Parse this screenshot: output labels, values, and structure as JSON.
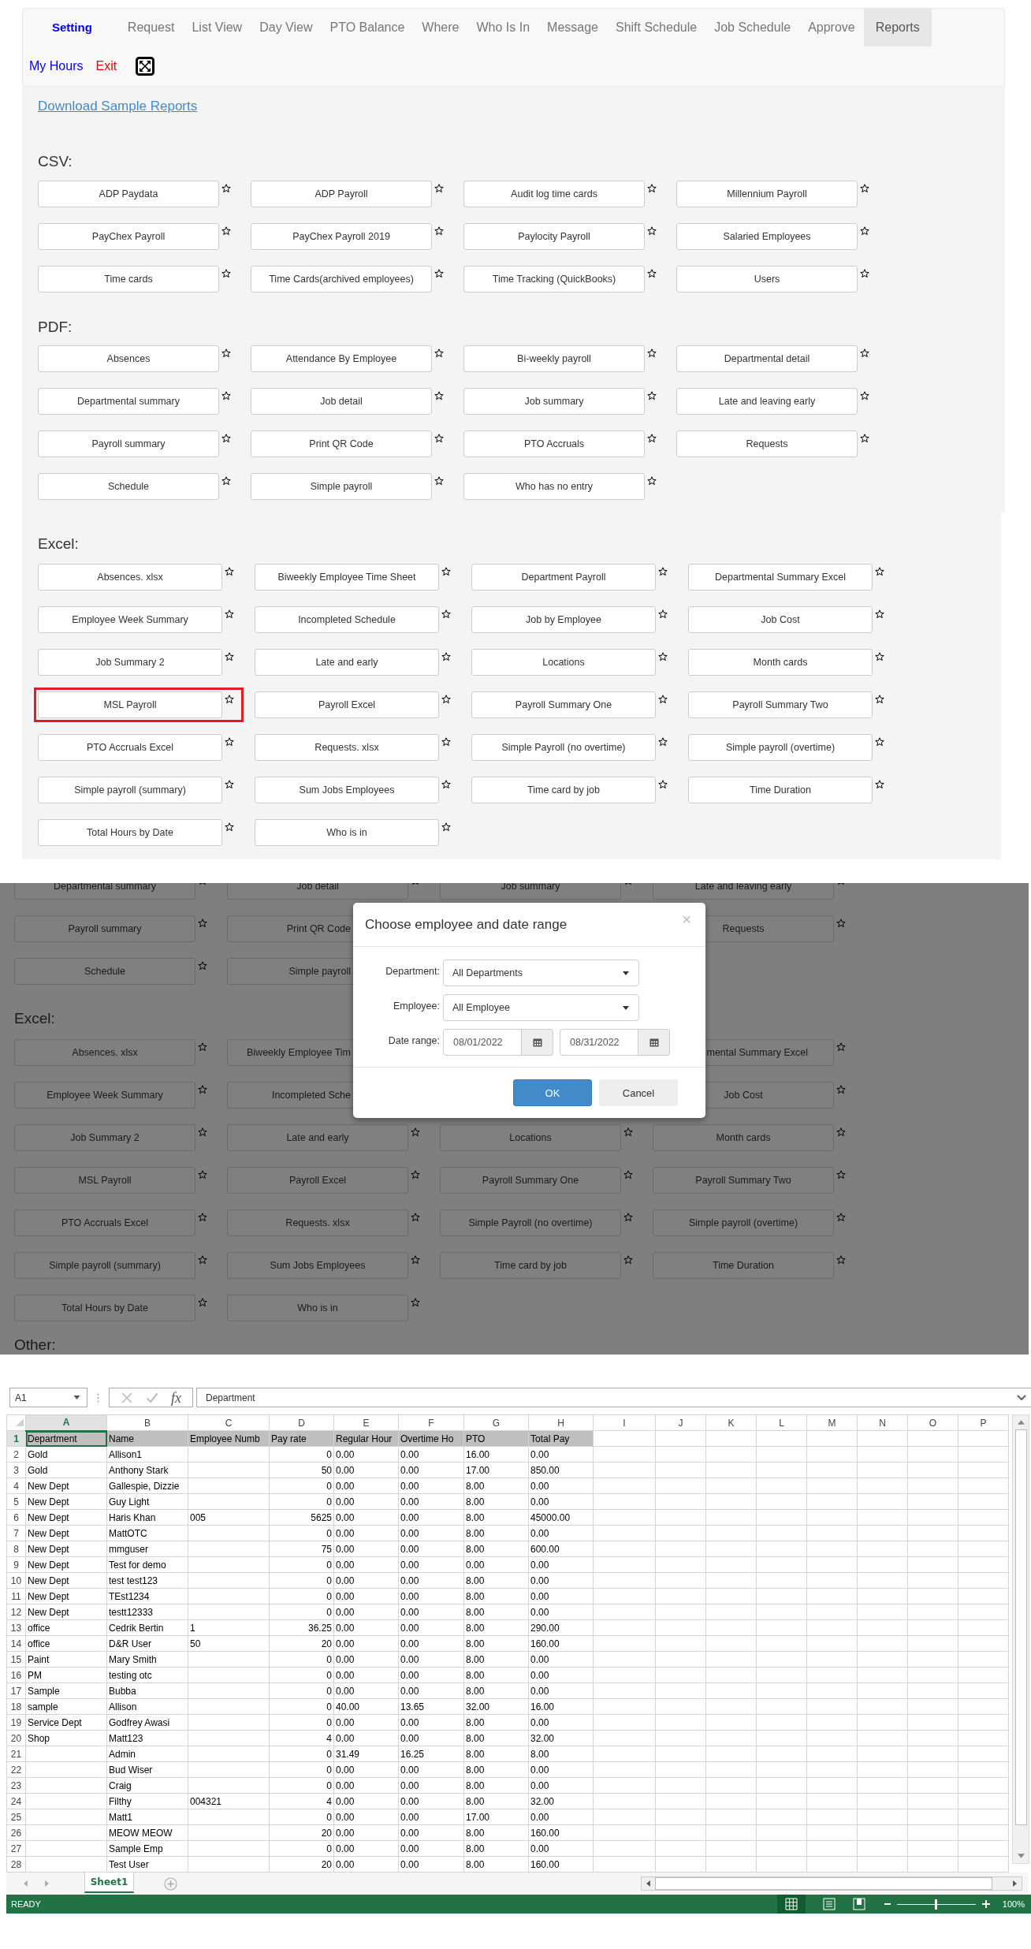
{
  "nav": {
    "brand": "Setting",
    "tabs": [
      {
        "label": "Request",
        "selected": false
      },
      {
        "label": "List View",
        "selected": false
      },
      {
        "label": "Day View",
        "selected": false
      },
      {
        "label": "PTO Balance",
        "selected": false
      },
      {
        "label": "Where",
        "selected": false
      },
      {
        "label": "Who Is In",
        "selected": false
      },
      {
        "label": "Message",
        "selected": false
      },
      {
        "label": "Shift Schedule",
        "selected": false
      },
      {
        "label": "Job Schedule",
        "selected": false
      },
      {
        "label": "Approve",
        "selected": false
      },
      {
        "label": "Reports",
        "selected": true
      }
    ],
    "links": [
      {
        "label": "My Hours",
        "kind": "hours"
      },
      {
        "label": "Exit",
        "kind": "exit"
      }
    ]
  },
  "download_link": "Download Sample Reports",
  "report_sections": [
    {
      "title": "CSV:",
      "reports": [
        {
          "label": "ADP Paydata"
        },
        {
          "label": "ADP Payroll"
        },
        {
          "label": "Audit log time cards"
        },
        {
          "label": "Millennium Payroll"
        },
        {
          "label": "PayChex Payroll"
        },
        {
          "label": "PayChex Payroll 2019"
        },
        {
          "label": "Paylocity Payroll"
        },
        {
          "label": "Salaried Employees"
        },
        {
          "label": "Time cards"
        },
        {
          "label": "Time Cards(archived employees)"
        },
        {
          "label": "Time Tracking (QuickBooks)"
        },
        {
          "label": "Users"
        }
      ]
    },
    {
      "title": "PDF:",
      "reports": [
        {
          "label": "Absences"
        },
        {
          "label": "Attendance By Employee"
        },
        {
          "label": "Bi-weekly payroll"
        },
        {
          "label": "Departmental detail"
        },
        {
          "label": "Departmental summary"
        },
        {
          "label": "Job detail"
        },
        {
          "label": "Job summary"
        },
        {
          "label": "Late and leaving early"
        },
        {
          "label": "Payroll summary"
        },
        {
          "label": "Print QR Code"
        },
        {
          "label": "PTO Accruals"
        },
        {
          "label": "Requests"
        },
        {
          "label": "Schedule"
        },
        {
          "label": "Simple payroll"
        },
        {
          "label": "Who has no entry"
        }
      ]
    },
    {
      "title": "Excel:",
      "reports": [
        {
          "label": "Absences. xlsx",
          "highlighted": false
        },
        {
          "label": "Biweekly Employee Time Sheet",
          "highlighted": false
        },
        {
          "label": "Department Payroll",
          "highlighted": false
        },
        {
          "label": "Departmental Summary Excel",
          "highlighted": false
        },
        {
          "label": "Employee Week Summary",
          "highlighted": false
        },
        {
          "label": "Incompleted Schedule",
          "highlighted": false
        },
        {
          "label": "Job by Employee",
          "highlighted": false
        },
        {
          "label": "Job Cost",
          "highlighted": false
        },
        {
          "label": "Job Summary 2",
          "highlighted": false
        },
        {
          "label": "Late and early",
          "highlighted": false
        },
        {
          "label": "Locations",
          "highlighted": false
        },
        {
          "label": "Month cards",
          "highlighted": false
        },
        {
          "label": "MSL Payroll",
          "highlighted": true
        },
        {
          "label": "Payroll Excel",
          "highlighted": false
        },
        {
          "label": "Payroll Summary One",
          "highlighted": false
        },
        {
          "label": "Payroll Summary Two",
          "highlighted": false
        },
        {
          "label": "PTO Accruals Excel",
          "highlighted": false
        },
        {
          "label": "Requests. xlsx",
          "highlighted": false
        },
        {
          "label": "Simple Payroll (no overtime)",
          "highlighted": false
        },
        {
          "label": "Simple payroll (overtime)",
          "highlighted": false
        },
        {
          "label": "Simple payroll (summary)",
          "highlighted": false
        },
        {
          "label": "Sum Jobs Employees",
          "highlighted": false
        },
        {
          "label": "Time card by job",
          "highlighted": false
        },
        {
          "label": "Time Duration",
          "highlighted": false
        },
        {
          "label": "Total Hours by Date",
          "highlighted": false
        },
        {
          "label": "Who is in",
          "highlighted": false
        }
      ]
    }
  ],
  "dialog_view": {
    "background": [
      {
        "kind": "row",
        "cells": [
          {
            "kind": "full",
            "label": "Departmental summary"
          },
          {
            "kind": "full",
            "label": "Job detail"
          },
          {
            "kind": "full",
            "label": "Job summary"
          },
          {
            "kind": "full",
            "label": "Late and leaving early"
          }
        ]
      },
      {
        "kind": "row",
        "cells": [
          {
            "kind": "full",
            "label": "Payroll summary"
          },
          {
            "kind": "cut_right",
            "label": "Print QR Code"
          },
          {
            "kind": "covered"
          },
          {
            "kind": "full",
            "label": "Requests"
          }
        ]
      },
      {
        "kind": "row",
        "cells": [
          {
            "kind": "full",
            "label": "Schedule"
          },
          {
            "kind": "cut_right",
            "label": "Simple payroll"
          },
          {
            "kind": "covered"
          }
        ]
      },
      {
        "kind": "heading",
        "text": "Excel:"
      },
      {
        "kind": "row",
        "cells": [
          {
            "kind": "full",
            "label": "Absences. xlsx"
          },
          {
            "kind": "cut_right",
            "label": "Biweekly Employee Tim"
          },
          {
            "kind": "covered"
          },
          {
            "kind": "cut_left",
            "label": "mental Summary Excel"
          }
        ]
      },
      {
        "kind": "row",
        "cells": [
          {
            "kind": "full",
            "label": "Employee Week Summary"
          },
          {
            "kind": "cut_right",
            "label": "Incompleted Sche"
          },
          {
            "kind": "covered"
          },
          {
            "kind": "full",
            "label": "Job Cost"
          }
        ]
      },
      {
        "kind": "row",
        "cells": [
          {
            "kind": "full",
            "label": "Job Summary 2"
          },
          {
            "kind": "full",
            "label": "Late and early"
          },
          {
            "kind": "full",
            "label": "Locations"
          },
          {
            "kind": "full",
            "label": "Month cards"
          }
        ]
      },
      {
        "kind": "row",
        "cells": [
          {
            "kind": "full",
            "label": "MSL Payroll"
          },
          {
            "kind": "full",
            "label": "Payroll Excel"
          },
          {
            "kind": "full",
            "label": "Payroll Summary One"
          },
          {
            "kind": "full",
            "label": "Payroll Summary Two"
          }
        ]
      },
      {
        "kind": "row",
        "cells": [
          {
            "kind": "full",
            "label": "PTO Accruals Excel"
          },
          {
            "kind": "full",
            "label": "Requests. xlsx"
          },
          {
            "kind": "full",
            "label": "Simple Payroll (no overtime)"
          },
          {
            "kind": "full",
            "label": "Simple payroll (overtime)"
          }
        ]
      },
      {
        "kind": "row",
        "cells": [
          {
            "kind": "full",
            "label": "Simple payroll (summary)"
          },
          {
            "kind": "full",
            "label": "Sum Jobs Employees"
          },
          {
            "kind": "full",
            "label": "Time card by job"
          },
          {
            "kind": "full",
            "label": "Time Duration"
          }
        ]
      },
      {
        "kind": "row",
        "cells": [
          {
            "kind": "full",
            "label": "Total Hours by Date"
          },
          {
            "kind": "full",
            "label": "Who is in"
          }
        ]
      },
      {
        "kind": "heading",
        "text": "Other:"
      }
    ],
    "modal": {
      "title": "Choose employee and date range",
      "close": "×",
      "fields": [
        {
          "label": "Department:",
          "kind": "select",
          "value": "All Departments"
        },
        {
          "label": "Employee:",
          "kind": "select",
          "value": "All Employee"
        },
        {
          "label": "Date range:",
          "kind": "date_range",
          "values": [
            "08/01/2022",
            "08/31/2022"
          ]
        }
      ],
      "buttons": [
        {
          "label": "OK",
          "kind": "primary"
        },
        {
          "label": "Cancel",
          "kind": "default"
        }
      ]
    }
  },
  "spreadsheet": {
    "name_box": "A1",
    "function_symbol": "fx",
    "formula": "Department",
    "columns": [
      {
        "label": "A",
        "selected": true
      },
      {
        "label": "B",
        "selected": false
      },
      {
        "label": "C",
        "selected": false
      },
      {
        "label": "D",
        "selected": false
      },
      {
        "label": "E",
        "selected": false
      },
      {
        "label": "F",
        "selected": false
      },
      {
        "label": "G",
        "selected": false
      },
      {
        "label": "H",
        "selected": false
      },
      {
        "label": "I",
        "selected": false
      },
      {
        "label": "J",
        "selected": false
      },
      {
        "label": "K",
        "selected": false
      },
      {
        "label": "L",
        "selected": false
      },
      {
        "label": "M",
        "selected": false
      },
      {
        "label": "N",
        "selected": false
      },
      {
        "label": "O",
        "selected": false
      },
      {
        "label": "P",
        "selected": false
      }
    ],
    "rows": [
      {
        "number": "1",
        "selected": true,
        "kind": "header",
        "cells": [
          "Department",
          "Name",
          "Employee Numb",
          "Pay rate",
          "Regular Hour",
          "Overtime Ho",
          "PTO",
          "Total Pay"
        ]
      },
      {
        "number": "2",
        "selected": false,
        "kind": "data",
        "cells": [
          "Gold",
          "Allison1",
          null,
          "0",
          "0.00",
          "0.00",
          "16.00",
          "0.00"
        ]
      },
      {
        "number": "3",
        "selected": false,
        "kind": "data",
        "cells": [
          "Gold",
          "Anthony Stark",
          null,
          "50",
          "0.00",
          "0.00",
          "17.00",
          "850.00"
        ]
      },
      {
        "number": "4",
        "selected": false,
        "kind": "data",
        "cells": [
          "New Dept",
          "Gallespie, Dizzie",
          null,
          "0",
          "0.00",
          "0.00",
          "8.00",
          "0.00"
        ]
      },
      {
        "number": "5",
        "selected": false,
        "kind": "data",
        "cells": [
          "New Dept",
          "Guy Light",
          null,
          "0",
          "0.00",
          "0.00",
          "8.00",
          "0.00"
        ]
      },
      {
        "number": "6",
        "selected": false,
        "kind": "data",
        "cells": [
          "New Dept",
          "Haris Khan",
          "005",
          "5625",
          "0.00",
          "0.00",
          "8.00",
          "45000.00"
        ]
      },
      {
        "number": "7",
        "selected": false,
        "kind": "data",
        "cells": [
          "New Dept",
          "MattOTC",
          null,
          "0",
          "0.00",
          "0.00",
          "8.00",
          "0.00"
        ]
      },
      {
        "number": "8",
        "selected": false,
        "kind": "data",
        "cells": [
          "New Dept",
          "mmguser",
          null,
          "75",
          "0.00",
          "0.00",
          "8.00",
          "600.00"
        ]
      },
      {
        "number": "9",
        "selected": false,
        "kind": "data",
        "cells": [
          "New Dept",
          "Test for demo",
          null,
          "0",
          "0.00",
          "0.00",
          "0.00",
          "0.00"
        ]
      },
      {
        "number": "10",
        "selected": false,
        "kind": "data",
        "cells": [
          "New Dept",
          "test test123",
          null,
          "0",
          "0.00",
          "0.00",
          "8.00",
          "0.00"
        ]
      },
      {
        "number": "11",
        "selected": false,
        "kind": "data",
        "cells": [
          "New Dept",
          "TEst1234",
          null,
          "0",
          "0.00",
          "0.00",
          "8.00",
          "0.00"
        ]
      },
      {
        "number": "12",
        "selected": false,
        "kind": "data",
        "cells": [
          "New Dept",
          "testt12333",
          null,
          "0",
          "0.00",
          "0.00",
          "8.00",
          "0.00"
        ]
      },
      {
        "number": "13",
        "selected": false,
        "kind": "data",
        "cells": [
          "office",
          "Cedrik Bertin",
          "1",
          "36.25",
          "0.00",
          "0.00",
          "8.00",
          "290.00"
        ]
      },
      {
        "number": "14",
        "selected": false,
        "kind": "data",
        "cells": [
          "office",
          "D&R User",
          "50",
          "20",
          "0.00",
          "0.00",
          "8.00",
          "160.00"
        ]
      },
      {
        "number": "15",
        "selected": false,
        "kind": "data",
        "cells": [
          "Paint",
          "Mary Smith",
          null,
          "0",
          "0.00",
          "0.00",
          "8.00",
          "0.00"
        ]
      },
      {
        "number": "16",
        "selected": false,
        "kind": "data",
        "cells": [
          "PM",
          "testing otc",
          null,
          "0",
          "0.00",
          "0.00",
          "8.00",
          "0.00"
        ]
      },
      {
        "number": "17",
        "selected": false,
        "kind": "data",
        "cells": [
          "Sample",
          "Bubba",
          null,
          "0",
          "0.00",
          "0.00",
          "8.00",
          "0.00"
        ]
      },
      {
        "number": "18",
        "selected": false,
        "kind": "data",
        "cells": [
          "sample",
          "Allison",
          null,
          "0",
          "40.00",
          "13.65",
          "32.00",
          "16.00"
        ]
      },
      {
        "number": "19",
        "selected": false,
        "kind": "data",
        "cells": [
          "Service Dept",
          "Godfrey Awasi",
          null,
          "0",
          "0.00",
          "0.00",
          "8.00",
          "0.00"
        ]
      },
      {
        "number": "20",
        "selected": false,
        "kind": "data",
        "cells": [
          "Shop",
          "Matt123",
          null,
          "4",
          "0.00",
          "0.00",
          "8.00",
          "32.00"
        ]
      },
      {
        "number": "21",
        "selected": false,
        "kind": "data",
        "cells": [
          null,
          "Admin",
          null,
          "0",
          "31.49",
          "16.25",
          "8.00",
          "8.00"
        ]
      },
      {
        "number": "22",
        "selected": false,
        "kind": "data",
        "cells": [
          null,
          "Bud Wiser",
          null,
          "0",
          "0.00",
          "0.00",
          "8.00",
          "0.00"
        ]
      },
      {
        "number": "23",
        "selected": false,
        "kind": "data",
        "cells": [
          null,
          "Craig",
          null,
          "0",
          "0.00",
          "0.00",
          "8.00",
          "0.00"
        ]
      },
      {
        "number": "24",
        "selected": false,
        "kind": "data",
        "cells": [
          null,
          "Filthy",
          "004321",
          "4",
          "0.00",
          "0.00",
          "8.00",
          "32.00"
        ]
      },
      {
        "number": "25",
        "selected": false,
        "kind": "data",
        "cells": [
          null,
          "Matt1",
          null,
          "0",
          "0.00",
          "0.00",
          "17.00",
          "0.00"
        ]
      },
      {
        "number": "26",
        "selected": false,
        "kind": "data",
        "cells": [
          null,
          "MEOW MEOW",
          null,
          "20",
          "0.00",
          "0.00",
          "8.00",
          "160.00"
        ]
      },
      {
        "number": "27",
        "selected": false,
        "kind": "data",
        "cells": [
          null,
          "Sample Emp",
          null,
          "0",
          "0.00",
          "0.00",
          "8.00",
          "0.00"
        ]
      },
      {
        "number": "28",
        "selected": false,
        "kind": "data",
        "cells": [
          null,
          "Test User",
          null,
          "20",
          "0.00",
          "0.00",
          "8.00",
          "160.00"
        ]
      }
    ],
    "sheet_tabs": [
      {
        "label": "Sheet1",
        "selected": true
      }
    ],
    "status": "READY",
    "zoom": {
      "level": 0.5,
      "reading": "100%"
    }
  }
}
